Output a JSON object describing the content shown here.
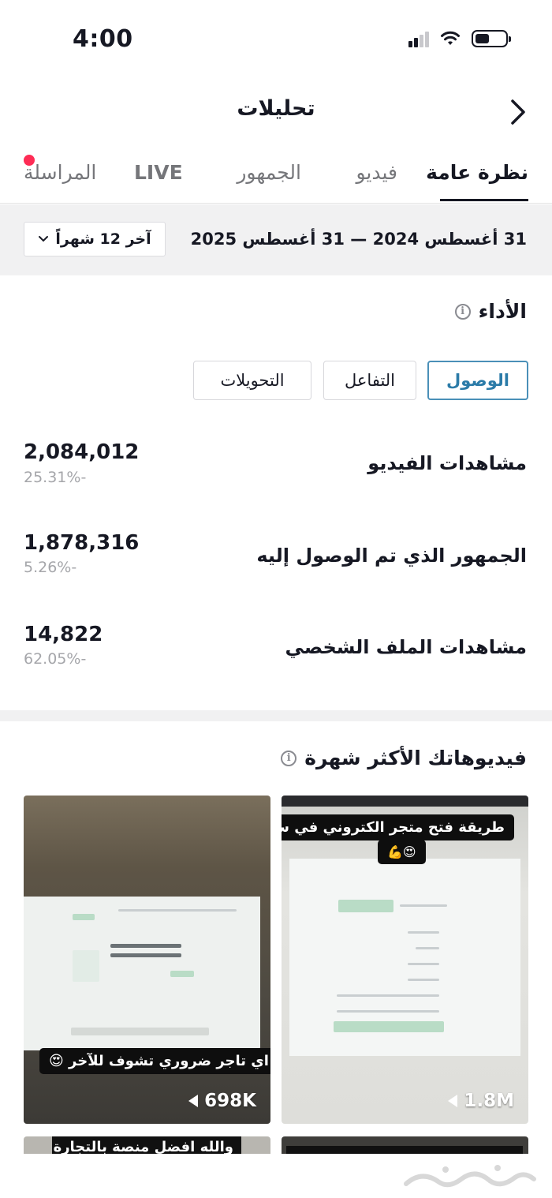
{
  "status": {
    "time": "4:00"
  },
  "header": {
    "title": "تحليلات"
  },
  "tabs": [
    {
      "label": "نظرة عامة",
      "active": true
    },
    {
      "label": "فيديو",
      "active": false
    },
    {
      "label": "الجمهور",
      "active": false
    },
    {
      "label": "LIVE",
      "active": false
    },
    {
      "label": "المراسلة",
      "active": false,
      "notification": true
    }
  ],
  "date_bar": {
    "range": "31 أغسطس 2024 — 31 أغسطس 2025",
    "select_label": "آخر 12 شهراً"
  },
  "performance": {
    "title": "الأداء",
    "segments": [
      {
        "label": "الوصول",
        "active": true
      },
      {
        "label": "التفاعل",
        "active": false
      },
      {
        "label": "التحويلات",
        "active": false
      }
    ],
    "metrics": [
      {
        "label": "مشاهدات الفيديو",
        "value": "2,084,012",
        "change": "25.31%-"
      },
      {
        "label": "الجمهور الذي تم الوصول إليه",
        "value": "1,878,316",
        "change": "5.26%-"
      },
      {
        "label": "مشاهدات الملف الشخصي",
        "value": "14,822",
        "change": "62.05%-"
      }
    ]
  },
  "top_videos": {
    "title": "فيديوهاتك الأكثر شهرة",
    "videos": [
      {
        "caption": "طريقة فتح متجر الكتروني في سلة",
        "caption_emoji": "😍💪",
        "views": "1.8M"
      },
      {
        "caption": "اي تاجر ضروري تشوف للآخر 😍",
        "views": "698K"
      }
    ],
    "partial_caption": "والله افضل منصة بالتجارة"
  },
  "colors": {
    "accent": "#2b7ba8",
    "notification": "#fe2c55",
    "text": "#161823",
    "muted": "#a5a6aa"
  }
}
